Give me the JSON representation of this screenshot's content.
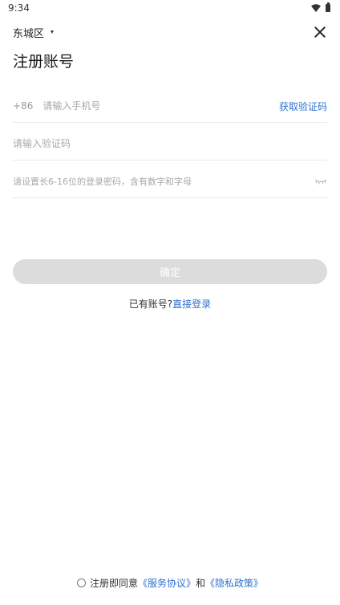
{
  "status_bar": {
    "time": "9:34",
    "icons": [
      "wifi-icon",
      "battery-icon"
    ]
  },
  "header": {
    "region": "东城区",
    "close_icon": "close-icon"
  },
  "page": {
    "title": "注册账号"
  },
  "form": {
    "phone": {
      "country_code": "+86",
      "placeholder": "请输入手机号",
      "value": "",
      "get_code_label": "获取验证码"
    },
    "code": {
      "placeholder": "请输入验证码",
      "value": ""
    },
    "password": {
      "placeholder": "请设置长6-16位的登录密码，含有数字和字母",
      "value": "",
      "toggle_icon": "eye-closed-icon"
    },
    "confirm_label": "确定",
    "confirm_enabled": false
  },
  "login": {
    "prompt": "已有账号?",
    "link": "直接登录"
  },
  "agreement": {
    "checked": false,
    "prefix": "注册即同意",
    "service": "《服务协议》",
    "and": "和",
    "privacy": "《隐私政策》"
  },
  "colors": {
    "accent": "#2f6fd1",
    "button_disabled": "#dcdcdc",
    "divider": "#e8e8e8",
    "placeholder": "#a8a8a8"
  }
}
